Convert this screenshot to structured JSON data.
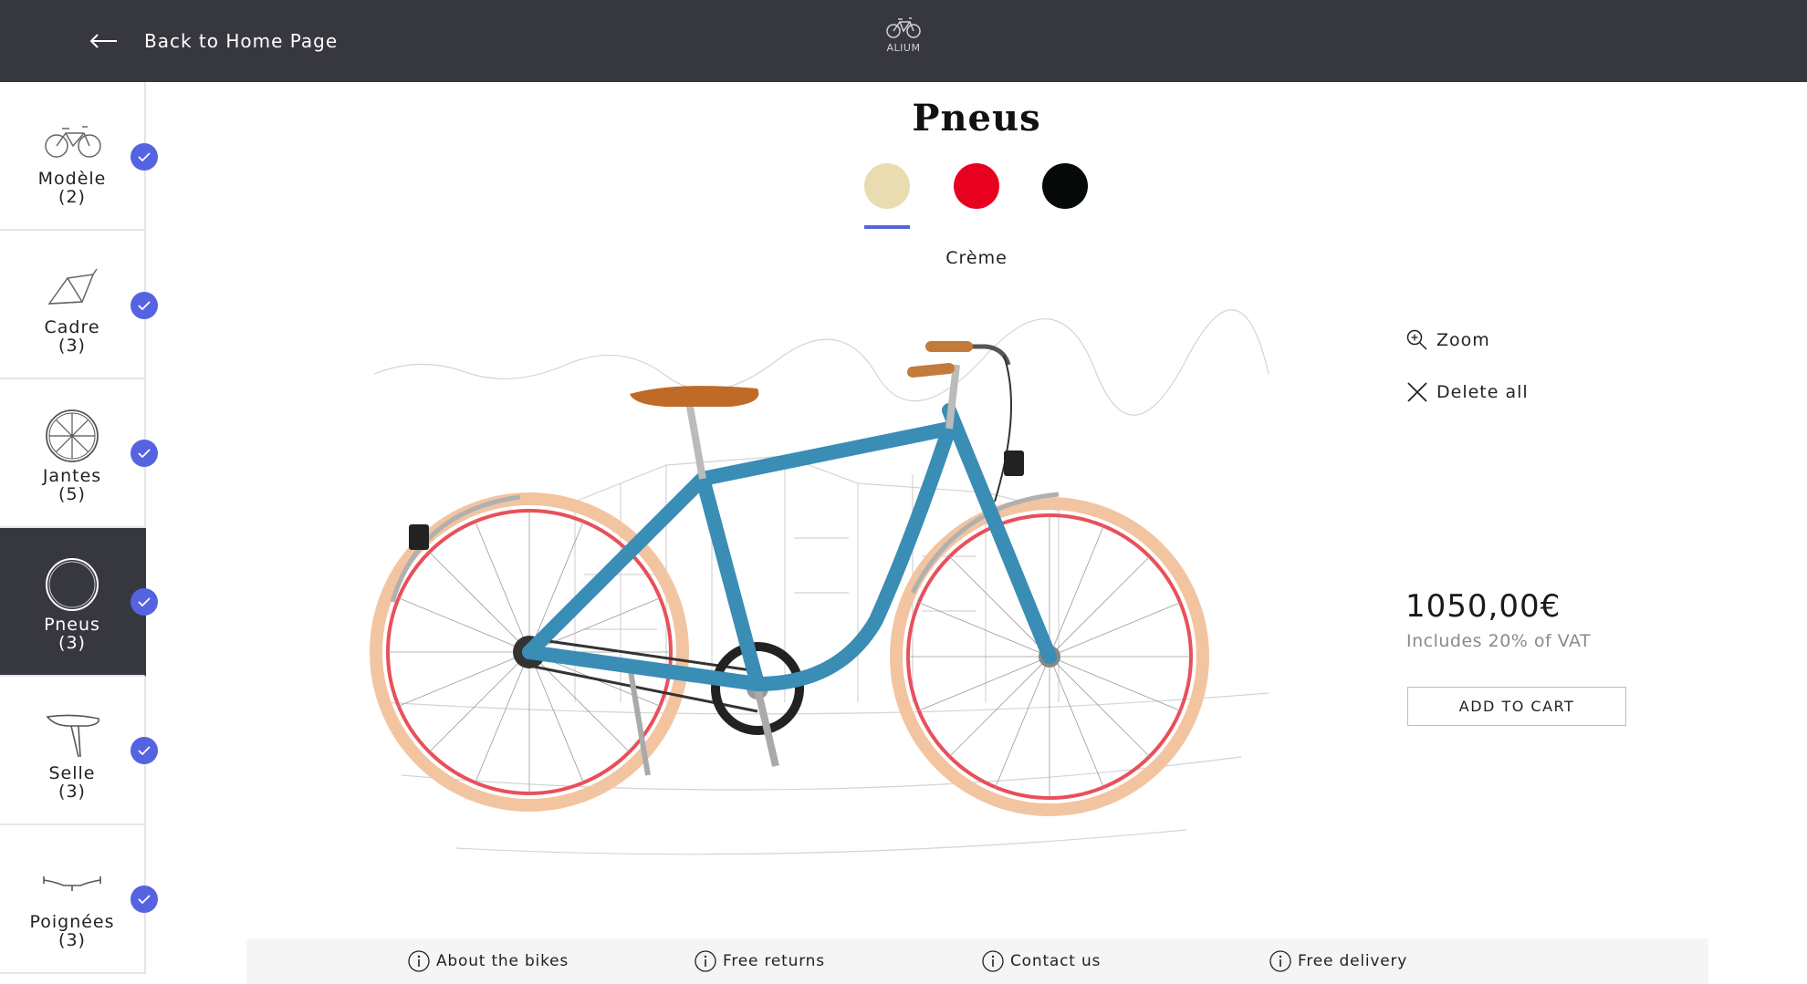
{
  "header": {
    "back_label": "Back to Home Page",
    "logo_text": "ALIUM"
  },
  "sidebar": {
    "items": [
      {
        "label": "Modèle",
        "count": "(2)",
        "icon": "bike-icon",
        "completed": true
      },
      {
        "label": "Cadre",
        "count": "(3)",
        "icon": "frame-icon",
        "completed": true
      },
      {
        "label": "Jantes",
        "count": "(5)",
        "icon": "rim-icon",
        "completed": true
      },
      {
        "label": "Pneus",
        "count": "(3)",
        "icon": "tire-icon",
        "completed": true,
        "active": true
      },
      {
        "label": "Selle",
        "count": "(3)",
        "icon": "saddle-icon",
        "completed": true
      },
      {
        "label": "Poignées",
        "count": "(3)",
        "icon": "handlebar-icon",
        "completed": true
      }
    ],
    "accent_color": "#5563e0"
  },
  "main": {
    "title": "Pneus",
    "swatches": [
      {
        "color": "#e8dcb0",
        "selected": true
      },
      {
        "color": "#e8001f",
        "selected": false
      },
      {
        "color": "#050a08",
        "selected": false
      }
    ],
    "selected_color_name": "Crème"
  },
  "actions": {
    "zoom_label": "Zoom",
    "delete_label": "Delete all"
  },
  "price": {
    "amount": "1050,00€",
    "vat_note": "Includes 20% of VAT",
    "cart_label": "ADD TO CART"
  },
  "footer": {
    "links": [
      {
        "label": "About the bikes",
        "icon": "info-icon"
      },
      {
        "label": "Free returns",
        "icon": "info-icon"
      },
      {
        "label": "Contact us",
        "icon": "info-icon"
      },
      {
        "label": "Free delivery",
        "icon": "info-icon"
      }
    ]
  },
  "colors": {
    "header_bg": "#373740",
    "bike_frame": "#3a8db5",
    "tire": "#f2c4a0",
    "rim": "#e8505a"
  }
}
